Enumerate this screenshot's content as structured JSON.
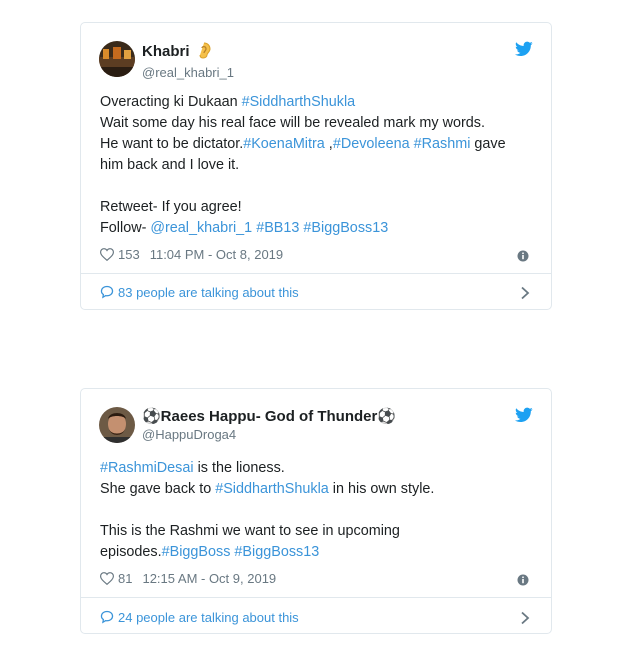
{
  "tweets": [
    {
      "display_name": "Khabri",
      "name_suffix_icon": "ear-emoji",
      "handle": "@real_khabri_1",
      "body_lines": [
        [
          {
            "t": "Overacting ki Dukaan "
          },
          {
            "t": "#SiddharthShukla",
            "tag": true
          }
        ],
        [
          {
            "t": "Wait some day his real face will be revealed mark my words."
          }
        ],
        [
          {
            "t": "He want to be dictator."
          },
          {
            "t": "#KoenaMitra",
            "tag": true
          },
          {
            "t": " ,"
          },
          {
            "t": "#Devoleena",
            "tag": true
          },
          {
            "t": " "
          },
          {
            "t": "#Rashmi",
            "tag": true
          },
          {
            "t": " gave"
          }
        ],
        [
          {
            "t": "him back and I love it."
          }
        ],
        [
          {
            "t": ""
          }
        ],
        [
          {
            "t": "Retweet- If you agree!"
          }
        ],
        [
          {
            "t": "Follow- "
          },
          {
            "t": "@real_khabri_1",
            "tag": true
          },
          {
            "t": " "
          },
          {
            "t": "#BB13",
            "tag": true
          },
          {
            "t": " "
          },
          {
            "t": "#BiggBoss13",
            "tag": true
          }
        ]
      ],
      "likes": "153",
      "timestamp": "11:04 PM - Oct 8, 2019",
      "talking": "83 people are talking about this"
    },
    {
      "display_name": "⚽Raees Happu- God of Thunder⚽",
      "name_suffix_icon": "",
      "handle": "@HappuDroga4",
      "body_lines": [
        [
          {
            "t": "#RashmiDesai",
            "tag": true
          },
          {
            "t": " is the lioness."
          }
        ],
        [
          {
            "t": "She gave back to "
          },
          {
            "t": "#SiddharthShukla",
            "tag": true
          },
          {
            "t": " in his own style."
          }
        ],
        [
          {
            "t": ""
          }
        ],
        [
          {
            "t": "This is the Rashmi we want to see in upcoming"
          }
        ],
        [
          {
            "t": "episodes."
          },
          {
            "t": "#BiggBoss",
            "tag": true
          },
          {
            "t": " "
          },
          {
            "t": "#BiggBoss13",
            "tag": true
          }
        ]
      ],
      "likes": "81",
      "timestamp": "12:15 AM - Oct 9, 2019",
      "talking": "24 people are talking about this"
    }
  ],
  "colors": {
    "link": "#3b94d9",
    "twitter_blue": "#1da1f2",
    "muted": "#697882",
    "border": "#e1e8ed"
  },
  "icons": [
    "avatar",
    "twitter-bird-icon",
    "heart-icon",
    "info-icon",
    "comment-bubble-icon",
    "chevron-right-icon"
  ]
}
